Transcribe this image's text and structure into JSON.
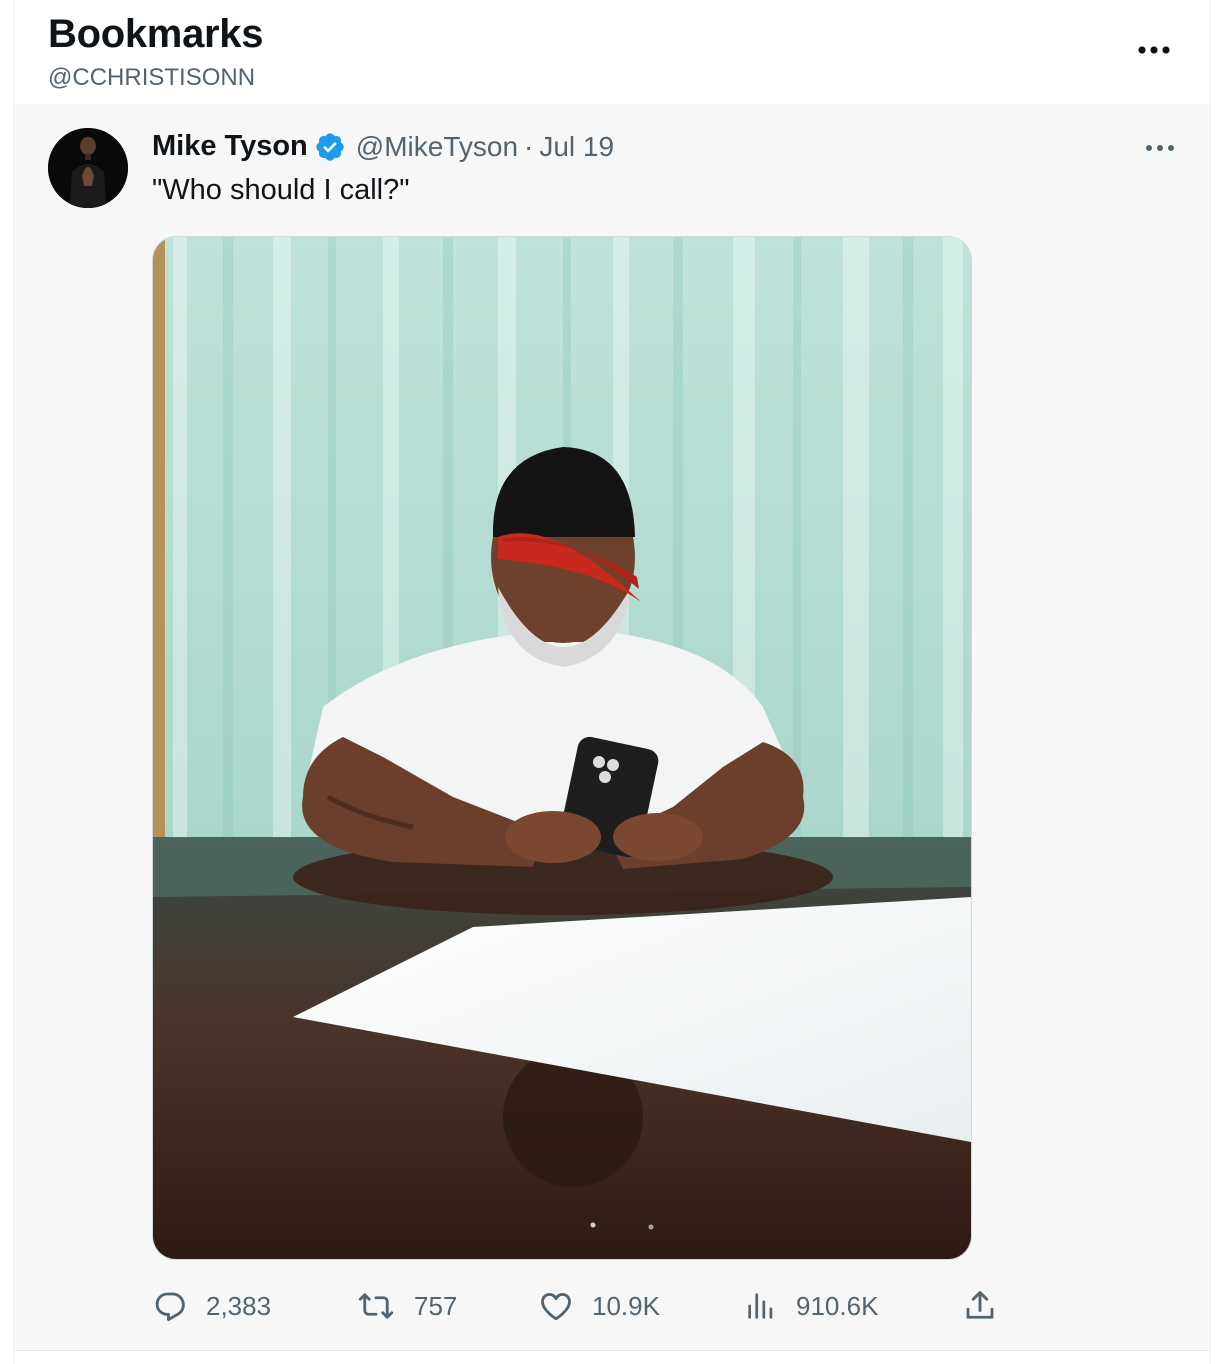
{
  "header": {
    "title": "Bookmarks",
    "account_handle": "@CCHRISTISONN",
    "more_icon": "more-horizontal-icon"
  },
  "tweet": {
    "author_name": "Mike Tyson",
    "verified_icon": "verified-badge-icon",
    "handle": "@MikeTyson",
    "separator": "·",
    "date": "Jul 19",
    "text": "\"Who should I call?\"",
    "media_alt": "",
    "actions": {
      "replies": {
        "icon": "reply-icon",
        "count": "2,383"
      },
      "retweets": {
        "icon": "retweet-icon",
        "count": "757"
      },
      "likes": {
        "icon": "like-icon",
        "count": "10.9K"
      },
      "views": {
        "icon": "views-icon",
        "count": "910.6K"
      },
      "share": {
        "icon": "share-icon"
      }
    }
  },
  "colors": {
    "text_primary": "#0f1419",
    "text_secondary": "#536471",
    "verified_blue": "#1d9bf0",
    "tweet_background": "#f7f7f7"
  }
}
